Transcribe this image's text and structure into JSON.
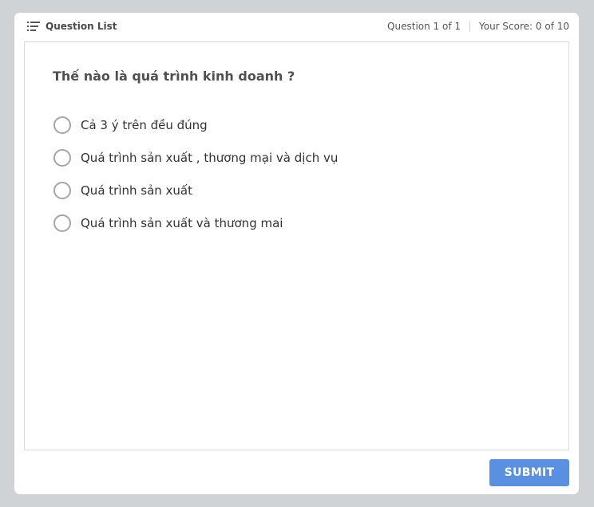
{
  "header": {
    "question_list_label": "Question List",
    "question_counter": "Question 1 of 1",
    "score": "Your Score: 0 of 10"
  },
  "question": {
    "text": "Thế nào là quá trình kinh doanh ?",
    "options": [
      {
        "label": "Cả 3 ý trên đều đúng",
        "selected": false
      },
      {
        "label": "Quá trình sản xuất , thương mại và dịch vụ",
        "selected": false
      },
      {
        "label": "Quá trình sản xuất",
        "selected": false
      },
      {
        "label": "Quá trình sản xuất và thương mai",
        "selected": false
      }
    ]
  },
  "actions": {
    "submit_label": "SUBMIT"
  },
  "colors": {
    "page_background": "#d0d3d6",
    "submit_button": "#5b8fe0",
    "radio_border": "#a5a5a5"
  },
  "icons": {
    "question_list": "list-icon"
  }
}
